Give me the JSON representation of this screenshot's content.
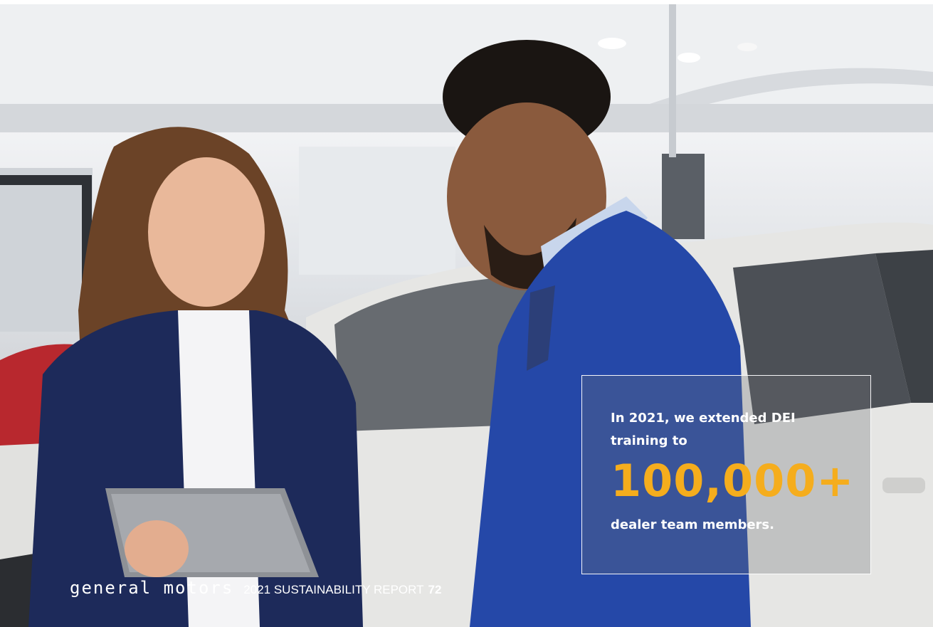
{
  "callout": {
    "lead": "In 2021, we extended DEI training to",
    "figure": "100,000+",
    "tail": "dealer team members."
  },
  "footer": {
    "brand": "general motors",
    "report": "2021 SUSTAINABILITY REPORT",
    "page_number": "72"
  },
  "colors": {
    "accent": "#f5ad1d",
    "text": "#ffffff"
  }
}
